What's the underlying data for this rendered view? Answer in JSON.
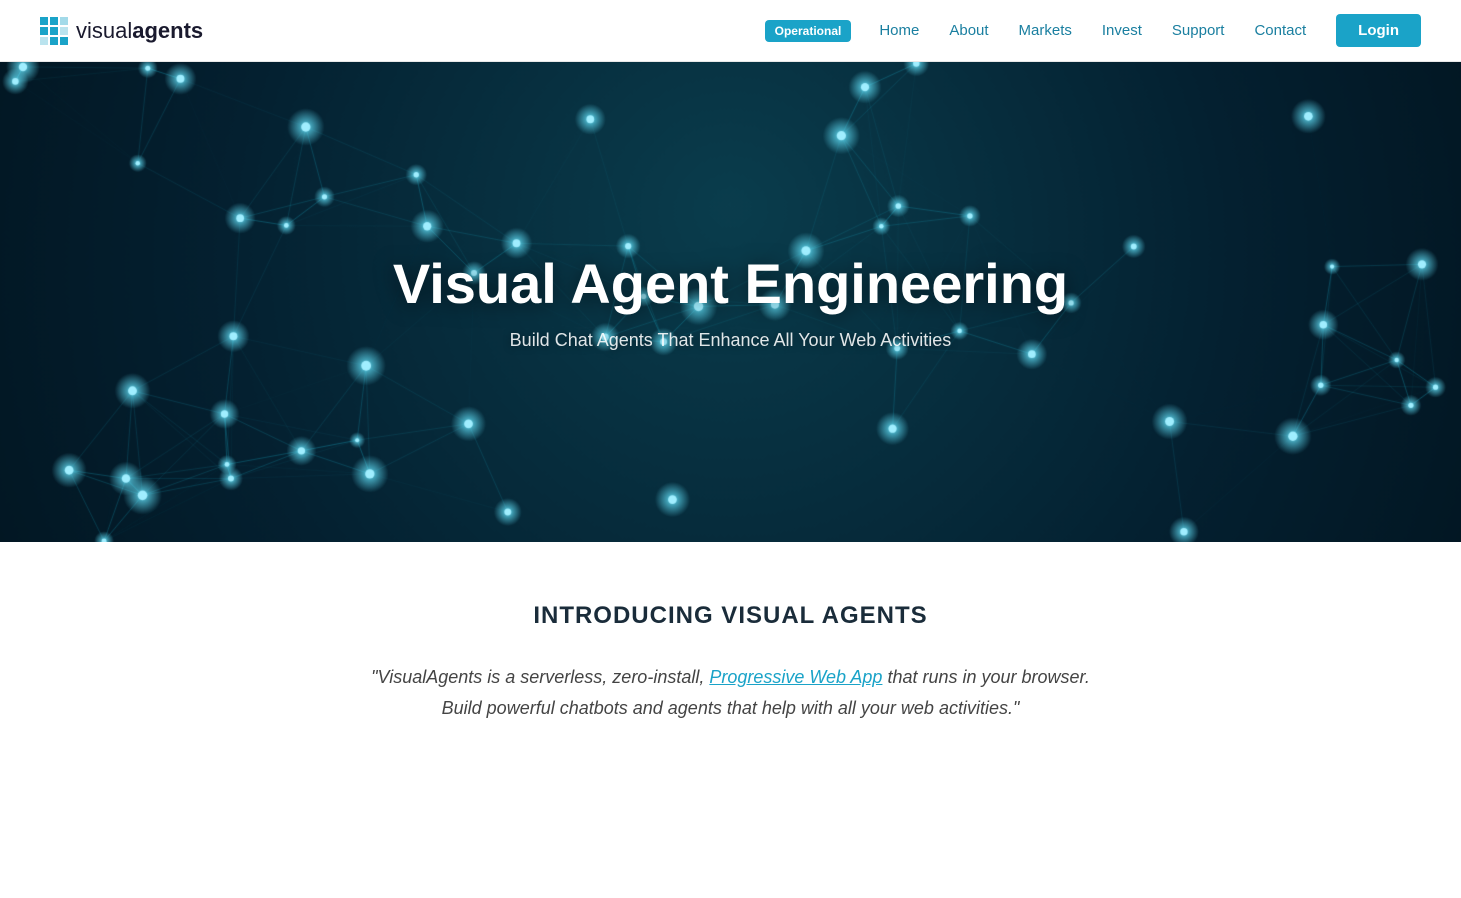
{
  "header": {
    "logo_visual": "visual",
    "logo_bold": "agents",
    "status_badge": "Operational",
    "nav": [
      {
        "label": "Home",
        "href": "#"
      },
      {
        "label": "About",
        "href": "#"
      },
      {
        "label": "Markets",
        "href": "#"
      },
      {
        "label": "Invest",
        "href": "#"
      },
      {
        "label": "Support",
        "href": "#"
      },
      {
        "label": "Contact",
        "href": "#"
      }
    ],
    "login_label": "Login"
  },
  "hero": {
    "title": "Visual Agent Engineering",
    "subtitle": "Build Chat Agents That Enhance All Your Web Activities"
  },
  "intro": {
    "heading": "INTRODUCING VISUAL AGENTS",
    "text_before_link": "\"VisualAgents is a serverless, zero-install, ",
    "link_text": "Progressive Web App",
    "text_after_link": " that runs in your browser. Build powerful chatbots and agents that help with all your web activities.\""
  }
}
